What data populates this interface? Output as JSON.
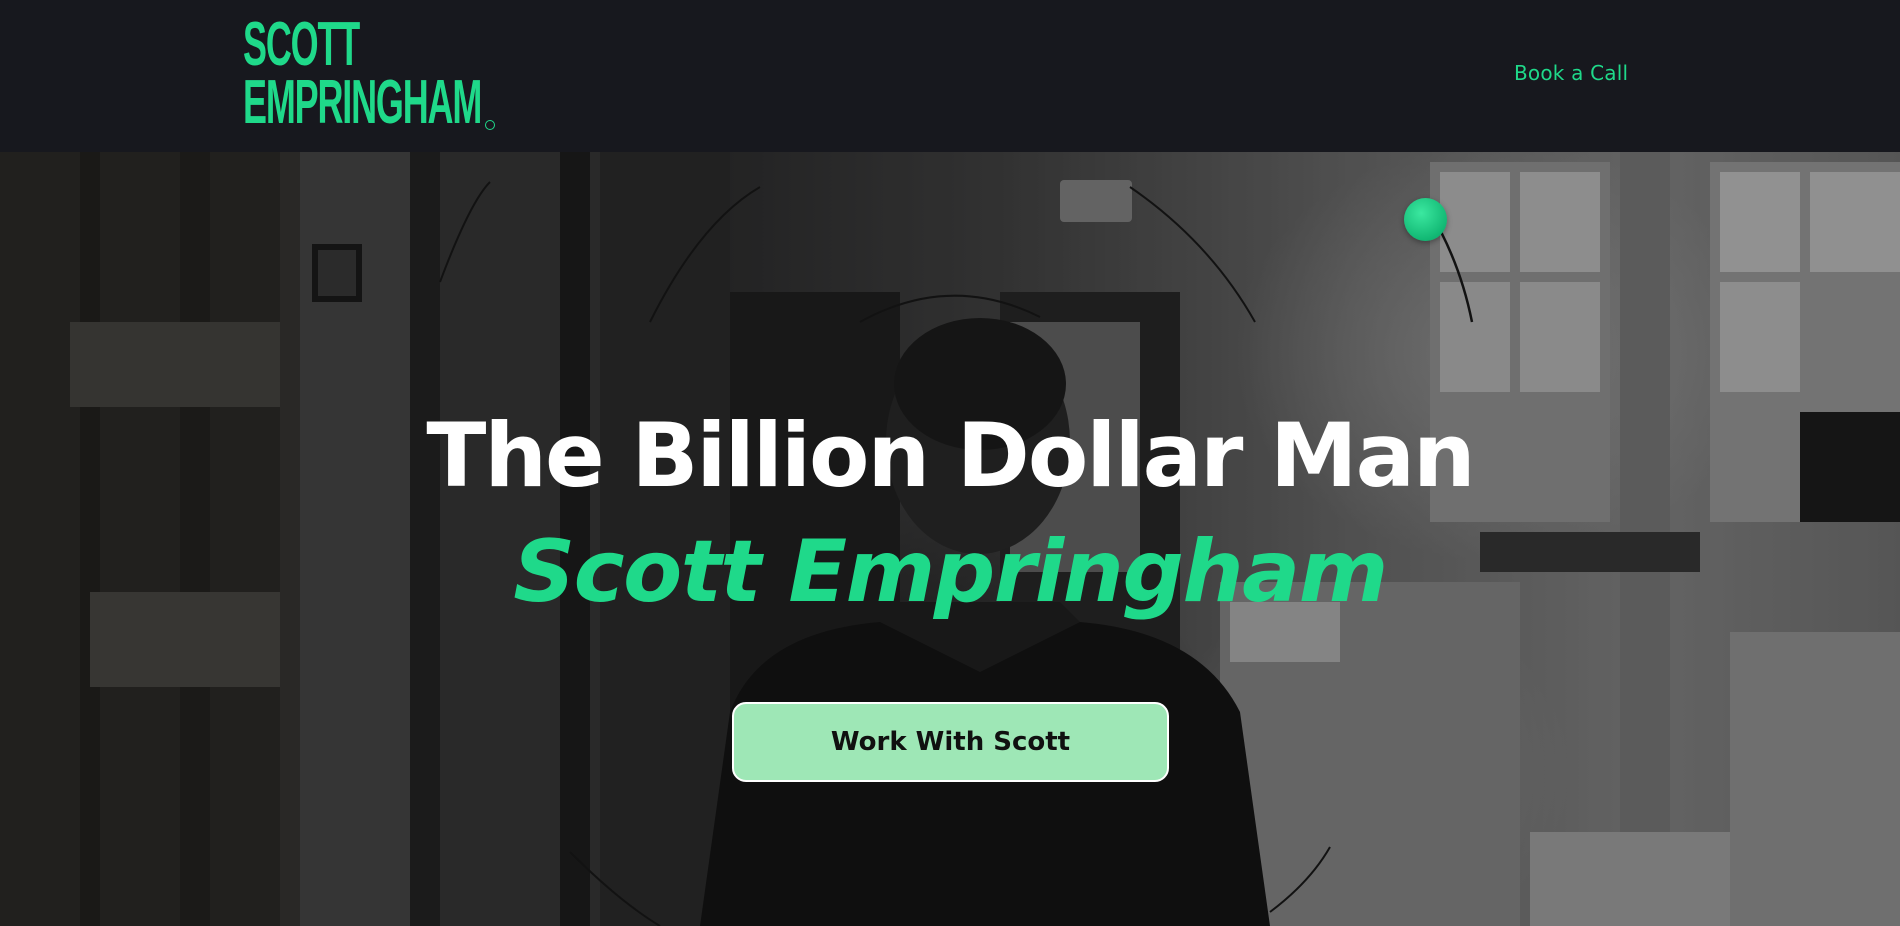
{
  "header": {
    "logo": {
      "line1": "SCOTT",
      "line2": "EMPRINGHAM"
    },
    "nav_cta": "Book a Call"
  },
  "hero": {
    "title": "The Billion Dollar Man",
    "subtitle": "Scott Empringham",
    "cta_label": "Work With Scott"
  },
  "colors": {
    "accent": "#1fd98a",
    "header_bg": "#17181e",
    "button_bg": "#9ee7b6",
    "title_text": "#ffffff"
  },
  "icons": {
    "logo_mark": "registered-trademark-icon",
    "decorative_orb": "green-dot-icon"
  }
}
